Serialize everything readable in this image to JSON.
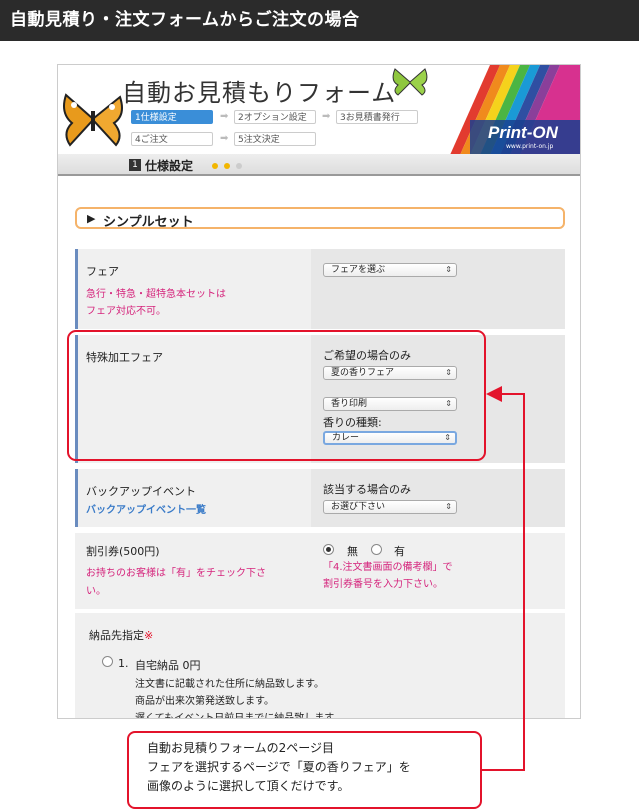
{
  "banner": {
    "title": "自動見積り・注文フォームからご注文の場合"
  },
  "header": {
    "form_title": "自動お見積もりフォーム",
    "brand": "Print-ON",
    "brand_url": "www.print-on.jp",
    "steps": [
      {
        "label": "1仕様設定",
        "active": true
      },
      {
        "label": "2オプション設定",
        "active": false
      },
      {
        "label": "3お見積書発行",
        "active": false
      },
      {
        "label": "4ご注文",
        "active": false
      },
      {
        "label": "5注文決定",
        "active": false
      }
    ]
  },
  "section": {
    "number": "1",
    "title": "仕様設定"
  },
  "simple_set": {
    "label": "シンプルセット"
  },
  "fair": {
    "label": "フェア",
    "select_value": "フェアを選ぶ",
    "note_line1": "急行・特急・超特急本セットは",
    "note_line2": "フェア対応不可。"
  },
  "special_fair": {
    "label": "特殊加工フェア",
    "hint": "ご希望の場合のみ",
    "select1": "夏の香りフェア",
    "select2": "香り印刷",
    "scent_label": "香りの種類:",
    "select3": "カレー"
  },
  "backup": {
    "label": "バックアップイベント",
    "link": "バックアップイベント一覧",
    "hint": "該当する場合のみ",
    "select_value": "お選び下さい"
  },
  "coupon": {
    "label": "割引券(500円)",
    "note_line1": "お持ちのお客様は「有」をチェック下さ",
    "note_line2": "い。",
    "option_no": "無",
    "option_yes": "有",
    "hint_line1": "「4.注文書画面の備考欄」で",
    "hint_line2": "割引券番号を入力下さい。"
  },
  "delivery": {
    "label": "納品先指定",
    "required_mark": "※",
    "option_number": "1.",
    "option_label": "自宅納品 0円",
    "desc1": "注文書に記載された住所に納品致します。",
    "desc2": "商品が出来次第発送致します。",
    "desc3": "遅くてもイベント日前日までに納品致します。"
  },
  "callout": {
    "line1": "自動お見積りフォームの2ページ目",
    "line2": "フェアを選択するページで「夏の香りフェア」を",
    "line3": "画像のように選択して頂くだけです。"
  },
  "colors": {
    "accent_red": "#e3132b",
    "pink_text": "#d5247c",
    "step_blue": "#3a8ed8",
    "orange_border": "#f5b36a"
  }
}
